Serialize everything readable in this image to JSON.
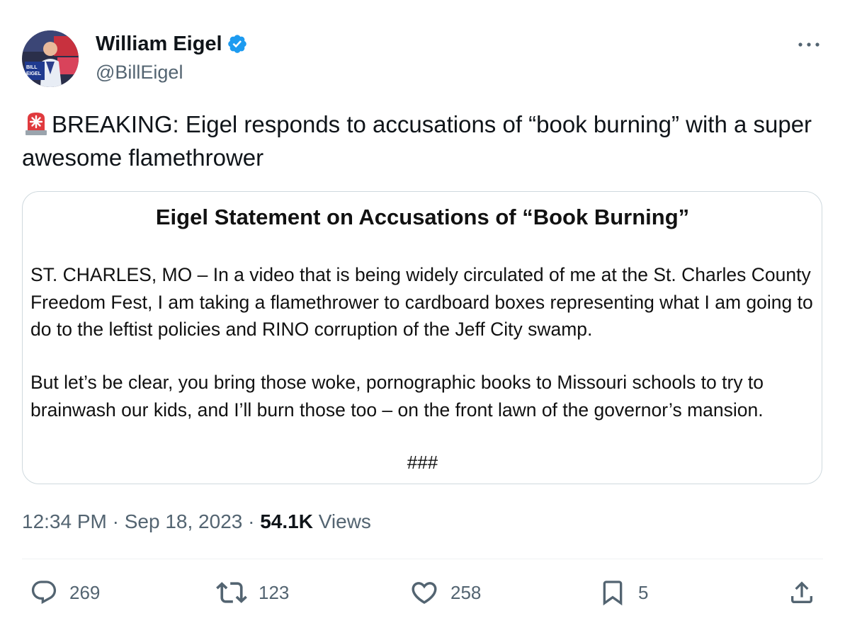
{
  "author": {
    "display_name": "William Eigel",
    "handle": "@BillEigel",
    "verified": true,
    "verified_color": "#1d9bf0",
    "avatar_sign_text": "BILL EIGEL"
  },
  "tweet": {
    "emoji": "siren-icon",
    "text": "BREAKING: Eigel responds to accusations of “book burning” with a super awesome flamethrower"
  },
  "statement": {
    "title": "Eigel Statement on Accusations of “Book Burning”",
    "paragraph_1": "ST. CHARLES, MO – In a video that is being widely circulated of me at the St. Charles County Freedom Fest, I am taking a flamethrower to cardboard boxes representing what I am going to do to the leftist policies and RINO corruption of the Jeff City swamp.",
    "paragraph_2": "But let’s be clear, you bring those woke, pornographic books to Missouri schools to try to brainwash our kids, and I’ll burn those too – on the front lawn of the governor’s mansion.",
    "end_mark": "###"
  },
  "meta": {
    "time": "12:34 PM",
    "separator": " · ",
    "date": "Sep 18, 2023",
    "views_count": "54.1K",
    "views_label": " Views"
  },
  "actions": {
    "replies": "269",
    "retweets": "123",
    "likes": "258",
    "bookmarks": "5"
  },
  "colors": {
    "text_primary": "#0f1419",
    "text_secondary": "#536471",
    "border": "#cfd9de",
    "verified": "#1d9bf0"
  }
}
